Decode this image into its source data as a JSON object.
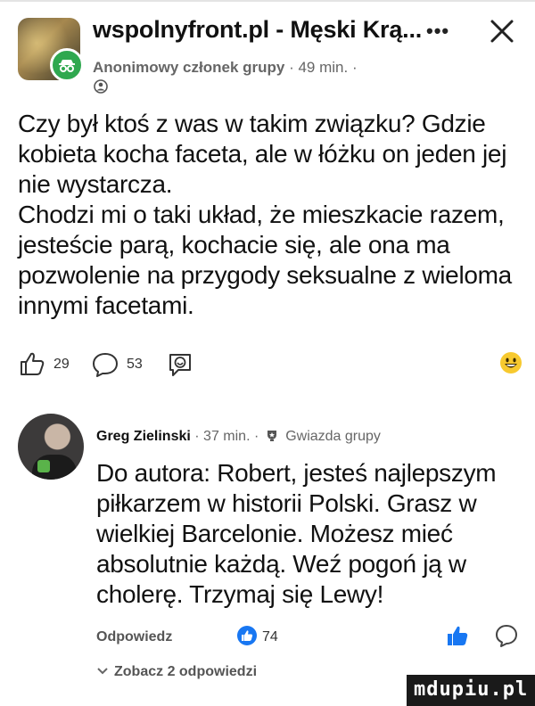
{
  "header": {
    "group_title": "wspolnyfront.pl - Męski Krą...",
    "author_name": "Anonimowy członek grupy",
    "time": "· 49 min. ·"
  },
  "post": {
    "paragraph_1": "Czy był ktoś z was w takim związku? Gdzie kobieta kocha faceta, ale w łóżku on jeden jej nie wystarcza.",
    "paragraph_2": "Chodzi mi o taki układ, że mieszkacie razem, jesteście parą, kochacie się, ale ona ma pozwolenie na przygody seksualne z wieloma innymi facetami."
  },
  "reactions": {
    "likes": "29",
    "comments": "53"
  },
  "comment": {
    "author": "Greg Zielinski",
    "time": "· 37 min. ·",
    "badge": "Gwiazda grupy",
    "text": "Do autora: Robert, jesteś najlepszym piłkarzem w historii Polski. Grasz w wielkiej Barcelonie. Możesz mieć absolutnie każdą. Weź pogoń ją w cholerę. Trzymaj się Lewy!",
    "reply_label": "Odpowiedz",
    "like_count": "74",
    "view_replies": "Zobacz 2 odpowiedzi"
  },
  "watermark": {
    "text": "mdupiu.pl"
  },
  "colors": {
    "accent_blue": "#1877f2",
    "anon_green": "#2fa84f",
    "meta_gray": "#666666"
  },
  "icons": {
    "close": "close-icon",
    "more": "more-icon",
    "like": "thumbs-up-outline-icon",
    "comment": "comment-bubble-icon",
    "share": "share-sticker-icon",
    "emoji": "grinning-face-icon",
    "star": "group-star-icon"
  }
}
